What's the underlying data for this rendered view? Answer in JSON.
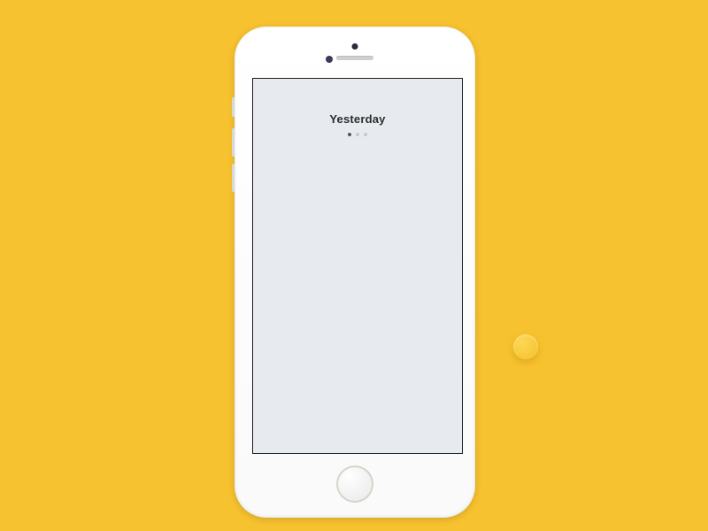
{
  "screen": {
    "title": "Yesterday",
    "page_index": 0,
    "page_count": 3
  }
}
